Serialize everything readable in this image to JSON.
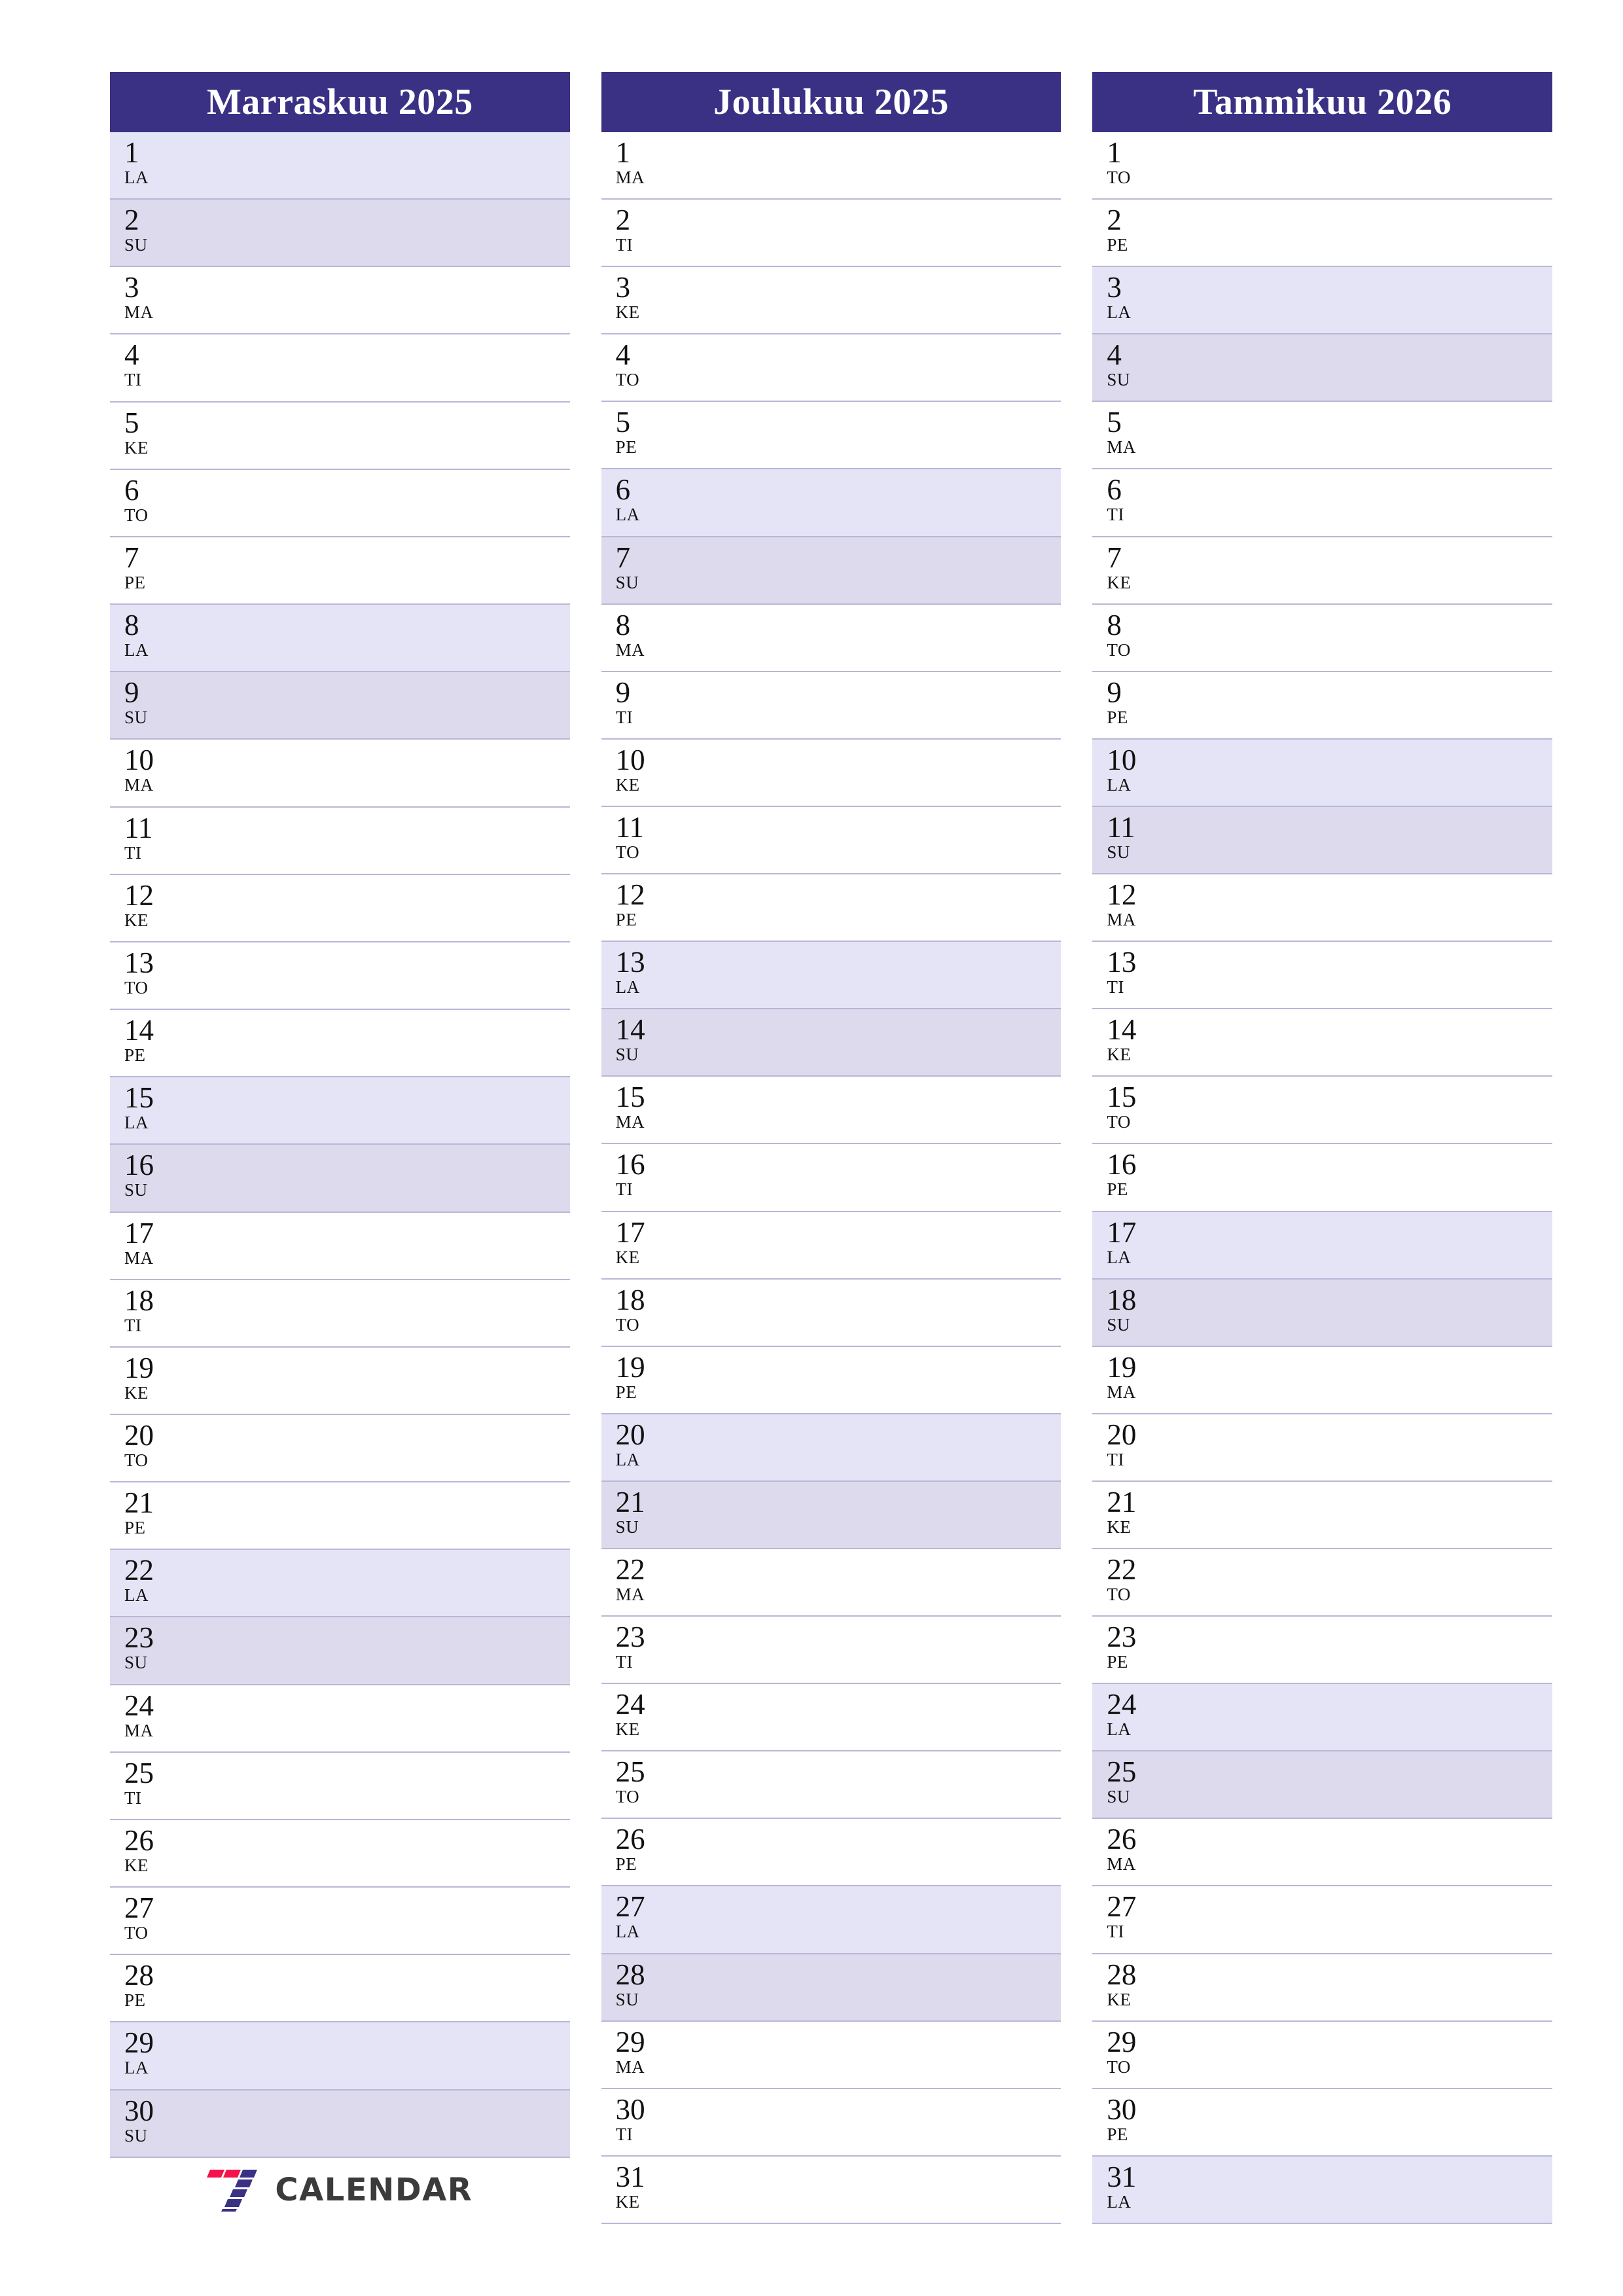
{
  "page": {
    "orientation": "portrait",
    "accent_color": "#3a3185",
    "saturday_color": "#e4e4f6",
    "sunday_color": "#dcdaec",
    "row_line_color": "#b9b7d6"
  },
  "logo": {
    "name": "7-calendar-logo",
    "text": "CALENDAR",
    "mark_colors": [
      "#f4134a",
      "#f4134a",
      "#3a3185",
      "#3a3185",
      "#3a3185",
      "#3a3185",
      "#3a3185"
    ]
  },
  "months": [
    {
      "title": "Marraskuu 2025",
      "days": [
        {
          "n": "1",
          "wd": "LA"
        },
        {
          "n": "2",
          "wd": "SU"
        },
        {
          "n": "3",
          "wd": "MA"
        },
        {
          "n": "4",
          "wd": "TI"
        },
        {
          "n": "5",
          "wd": "KE"
        },
        {
          "n": "6",
          "wd": "TO"
        },
        {
          "n": "7",
          "wd": "PE"
        },
        {
          "n": "8",
          "wd": "LA"
        },
        {
          "n": "9",
          "wd": "SU"
        },
        {
          "n": "10",
          "wd": "MA"
        },
        {
          "n": "11",
          "wd": "TI"
        },
        {
          "n": "12",
          "wd": "KE"
        },
        {
          "n": "13",
          "wd": "TO"
        },
        {
          "n": "14",
          "wd": "PE"
        },
        {
          "n": "15",
          "wd": "LA"
        },
        {
          "n": "16",
          "wd": "SU"
        },
        {
          "n": "17",
          "wd": "MA"
        },
        {
          "n": "18",
          "wd": "TI"
        },
        {
          "n": "19",
          "wd": "KE"
        },
        {
          "n": "20",
          "wd": "TO"
        },
        {
          "n": "21",
          "wd": "PE"
        },
        {
          "n": "22",
          "wd": "LA"
        },
        {
          "n": "23",
          "wd": "SU"
        },
        {
          "n": "24",
          "wd": "MA"
        },
        {
          "n": "25",
          "wd": "TI"
        },
        {
          "n": "26",
          "wd": "KE"
        },
        {
          "n": "27",
          "wd": "TO"
        },
        {
          "n": "28",
          "wd": "PE"
        },
        {
          "n": "29",
          "wd": "LA"
        },
        {
          "n": "30",
          "wd": "SU"
        }
      ]
    },
    {
      "title": "Joulukuu 2025",
      "days": [
        {
          "n": "1",
          "wd": "MA"
        },
        {
          "n": "2",
          "wd": "TI"
        },
        {
          "n": "3",
          "wd": "KE"
        },
        {
          "n": "4",
          "wd": "TO"
        },
        {
          "n": "5",
          "wd": "PE"
        },
        {
          "n": "6",
          "wd": "LA"
        },
        {
          "n": "7",
          "wd": "SU"
        },
        {
          "n": "8",
          "wd": "MA"
        },
        {
          "n": "9",
          "wd": "TI"
        },
        {
          "n": "10",
          "wd": "KE"
        },
        {
          "n": "11",
          "wd": "TO"
        },
        {
          "n": "12",
          "wd": "PE"
        },
        {
          "n": "13",
          "wd": "LA"
        },
        {
          "n": "14",
          "wd": "SU"
        },
        {
          "n": "15",
          "wd": "MA"
        },
        {
          "n": "16",
          "wd": "TI"
        },
        {
          "n": "17",
          "wd": "KE"
        },
        {
          "n": "18",
          "wd": "TO"
        },
        {
          "n": "19",
          "wd": "PE"
        },
        {
          "n": "20",
          "wd": "LA"
        },
        {
          "n": "21",
          "wd": "SU"
        },
        {
          "n": "22",
          "wd": "MA"
        },
        {
          "n": "23",
          "wd": "TI"
        },
        {
          "n": "24",
          "wd": "KE"
        },
        {
          "n": "25",
          "wd": "TO"
        },
        {
          "n": "26",
          "wd": "PE"
        },
        {
          "n": "27",
          "wd": "LA"
        },
        {
          "n": "28",
          "wd": "SU"
        },
        {
          "n": "29",
          "wd": "MA"
        },
        {
          "n": "30",
          "wd": "TI"
        },
        {
          "n": "31",
          "wd": "KE"
        }
      ]
    },
    {
      "title": "Tammikuu 2026",
      "days": [
        {
          "n": "1",
          "wd": "TO"
        },
        {
          "n": "2",
          "wd": "PE"
        },
        {
          "n": "3",
          "wd": "LA"
        },
        {
          "n": "4",
          "wd": "SU"
        },
        {
          "n": "5",
          "wd": "MA"
        },
        {
          "n": "6",
          "wd": "TI"
        },
        {
          "n": "7",
          "wd": "KE"
        },
        {
          "n": "8",
          "wd": "TO"
        },
        {
          "n": "9",
          "wd": "PE"
        },
        {
          "n": "10",
          "wd": "LA"
        },
        {
          "n": "11",
          "wd": "SU"
        },
        {
          "n": "12",
          "wd": "MA"
        },
        {
          "n": "13",
          "wd": "TI"
        },
        {
          "n": "14",
          "wd": "KE"
        },
        {
          "n": "15",
          "wd": "TO"
        },
        {
          "n": "16",
          "wd": "PE"
        },
        {
          "n": "17",
          "wd": "LA"
        },
        {
          "n": "18",
          "wd": "SU"
        },
        {
          "n": "19",
          "wd": "MA"
        },
        {
          "n": "20",
          "wd": "TI"
        },
        {
          "n": "21",
          "wd": "KE"
        },
        {
          "n": "22",
          "wd": "TO"
        },
        {
          "n": "23",
          "wd": "PE"
        },
        {
          "n": "24",
          "wd": "LA"
        },
        {
          "n": "25",
          "wd": "SU"
        },
        {
          "n": "26",
          "wd": "MA"
        },
        {
          "n": "27",
          "wd": "TI"
        },
        {
          "n": "28",
          "wd": "KE"
        },
        {
          "n": "29",
          "wd": "TO"
        },
        {
          "n": "30",
          "wd": "PE"
        },
        {
          "n": "31",
          "wd": "LA"
        }
      ]
    }
  ]
}
